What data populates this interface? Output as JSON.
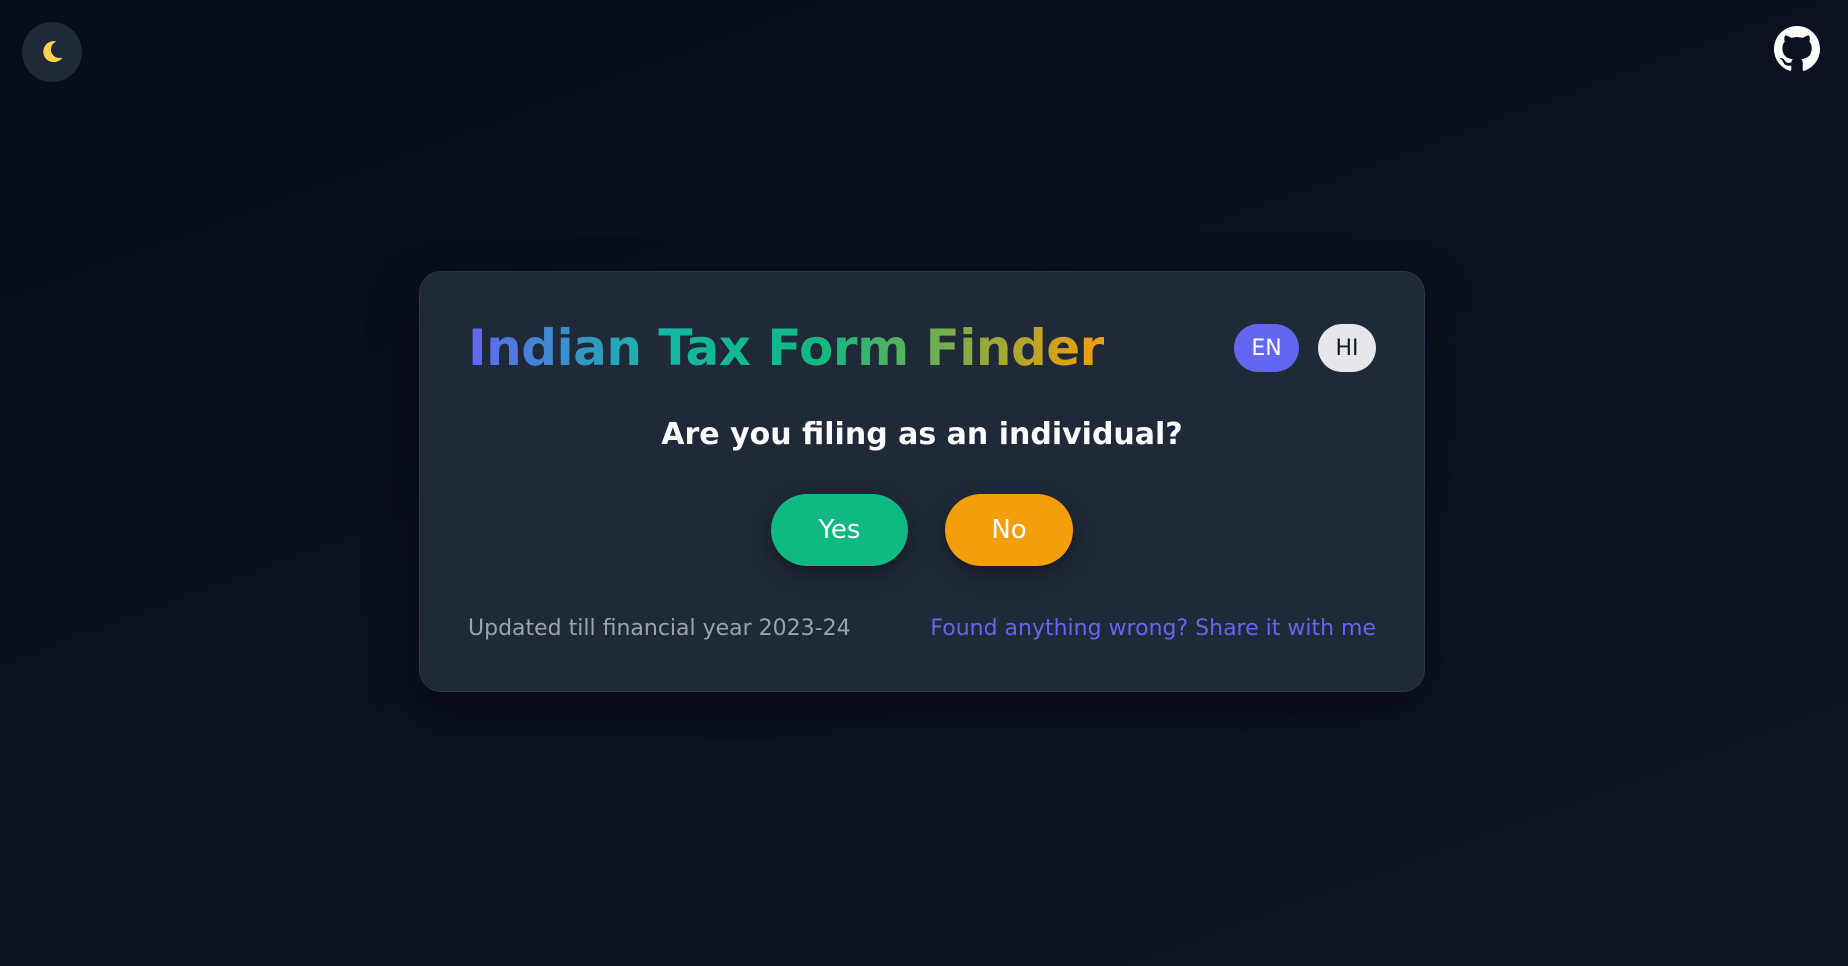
{
  "header": {
    "theme_toggle_icon": "moon-icon",
    "github_icon": "github-icon"
  },
  "card": {
    "title": "Indian Tax Form Finder",
    "languages": [
      {
        "code": "EN",
        "active": true
      },
      {
        "code": "HI",
        "active": false
      }
    ],
    "question": "Are you filing as an individual?",
    "answers": {
      "yes_label": "Yes",
      "no_label": "No"
    },
    "footer": {
      "updated_text": "Updated till financial year 2023-24",
      "report_link_text": "Found anything wrong? Share it with me"
    }
  },
  "colors": {
    "background": "#0b1120",
    "card": "#1f2937",
    "accent": "#6366f1",
    "yes": "#10b981",
    "no": "#f59e0b"
  }
}
